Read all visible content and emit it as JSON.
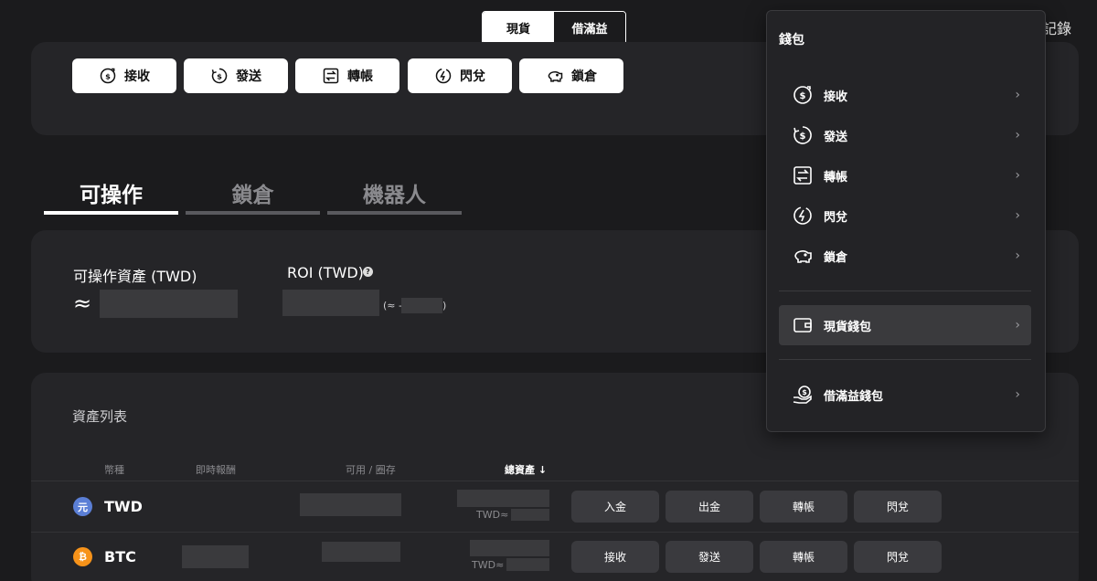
{
  "toggle": {
    "spot": "現貨",
    "margin": "借滿益"
  },
  "history_label": "記錄",
  "quick_actions": [
    {
      "label": "接收",
      "icon": "receive-icon"
    },
    {
      "label": "發送",
      "icon": "send-icon"
    },
    {
      "label": "轉帳",
      "icon": "transfer-icon"
    },
    {
      "label": "閃兌",
      "icon": "swap-icon"
    },
    {
      "label": "鎖倉",
      "icon": "piggy-bank-icon"
    }
  ],
  "tabs": [
    {
      "label": "可操作",
      "active": true
    },
    {
      "label": "鎖倉",
      "active": false
    },
    {
      "label": "機器人",
      "active": false
    }
  ],
  "assets": {
    "operable_label": "可操作資產 (TWD)",
    "approx": "≈",
    "roi_label": "ROI (TWD)",
    "roi_open": "(≈ -",
    "roi_close": ")"
  },
  "asset_list": {
    "title": "資產列表",
    "columns": [
      "幣種",
      "即時報酬",
      "可用 / 圈存",
      "總資產 ↓"
    ],
    "twd_prefix": "TWD≈",
    "rows": [
      {
        "symbol": "TWD",
        "coin_glyph": "元",
        "coin_color": "#5b7fd6",
        "actions": [
          "入金",
          "出金",
          "轉帳",
          "閃兌"
        ]
      },
      {
        "symbol": "BTC",
        "coin_glyph": "₿",
        "coin_color": "#f7931a",
        "actions": [
          "接收",
          "發送",
          "轉帳",
          "閃兌"
        ]
      }
    ]
  },
  "wallet_menu": {
    "title": "錢包",
    "items": [
      {
        "label": "接收",
        "icon": "receive-icon"
      },
      {
        "label": "發送",
        "icon": "send-icon"
      },
      {
        "label": "轉帳",
        "icon": "transfer-icon"
      },
      {
        "label": "閃兌",
        "icon": "swap-icon"
      },
      {
        "label": "鎖倉",
        "icon": "piggy-bank-icon"
      }
    ],
    "spot_wallet": "現貨錢包",
    "margin_wallet": "借滿益錢包",
    "chevron": "›"
  }
}
